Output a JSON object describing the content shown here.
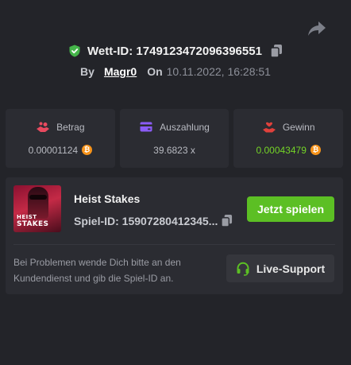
{
  "bet": {
    "id_label": "Wett-ID: 1749123472096396551",
    "by_label": "By",
    "user": "Magr0",
    "on_label": "On",
    "date": "10.11.2022, 16:28:51"
  },
  "stats": {
    "amount": {
      "label": "Betrag",
      "value": "0.00001124",
      "currency_icon": "bitcoin-coin",
      "icon": "hand-coins-icon",
      "icon_color": "#e84a5f"
    },
    "payout": {
      "label": "Auszahlung",
      "value": "39.6823 x",
      "icon": "wallet-card-icon",
      "icon_color": "#8b5cf6"
    },
    "win": {
      "label": "Gewinn",
      "value": "0.00043479",
      "currency_icon": "bitcoin-coin",
      "icon": "hand-heart-icon",
      "icon_color": "#e0413c",
      "value_color": "#74d427"
    }
  },
  "coin_symbol": "₿",
  "game": {
    "thumbnail_line1": "HEIST",
    "thumbnail_line2": "STAKES",
    "title": "Heist Stakes",
    "id_label": "Spiel-ID: 15907280412345...",
    "play_label": "Jetzt spielen"
  },
  "support": {
    "text": "Bei Problemen wende Dich bitte an den Kundendienst und gib die Spiel-ID an.",
    "button_label": "Live-Support",
    "icon": "headset-icon"
  },
  "colors": {
    "background": "#232429",
    "panel": "#2b2c32",
    "accent_green": "#5cbf24",
    "verified_green": "#45b54a",
    "bitcoin": "#f7931a"
  }
}
